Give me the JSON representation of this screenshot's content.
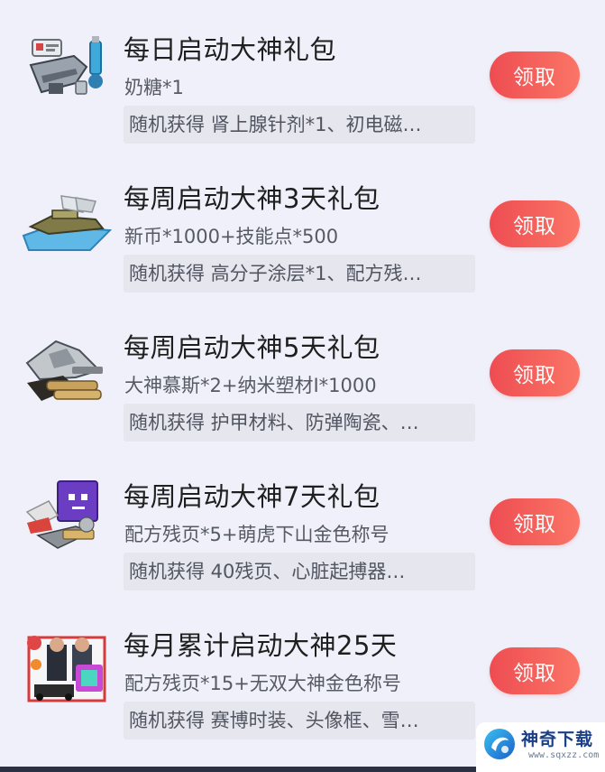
{
  "colors": {
    "background": "#f0f0fa",
    "button_start": "#ee4d52",
    "button_end": "#fb7566",
    "desc_background": "#e6e6ef"
  },
  "gifts": [
    {
      "title": "每日启动大神礼包",
      "subtitle": "奶糖*1",
      "description": "随机获得 肾上腺针剂*1、初电磁…",
      "button_label": "领取",
      "icon": "weapon-pack-icon"
    },
    {
      "title": "每周启动大神3天礼包",
      "subtitle": "新币*1000+技能点*500",
      "description": "随机获得 高分子涂层*1、配方残…",
      "button_label": "领取",
      "icon": "vehicle-pack-icon"
    },
    {
      "title": "每周启动大神5天礼包",
      "subtitle": "大神慕斯*2+纳米塑材Ⅰ*1000",
      "description": "随机获得 护甲材料、防弹陶瓷、…",
      "button_label": "领取",
      "icon": "materials-pack-icon"
    },
    {
      "title": "每周启动大神7天礼包",
      "subtitle": "配方残页*5+萌虎下山金色称号",
      "description": "随机获得 40残页、心脏起搏器…",
      "button_label": "领取",
      "icon": "box-character-pack-icon"
    },
    {
      "title": "每月累计启动大神25天",
      "subtitle": "配方残页*15+无双大神金色称号",
      "description": "随机获得 赛博时装、头像框、雪…",
      "button_label": "领取",
      "icon": "fashion-pack-icon"
    }
  ],
  "watermark": {
    "name": "神奇下载",
    "url": "www.sqxzz.com"
  }
}
